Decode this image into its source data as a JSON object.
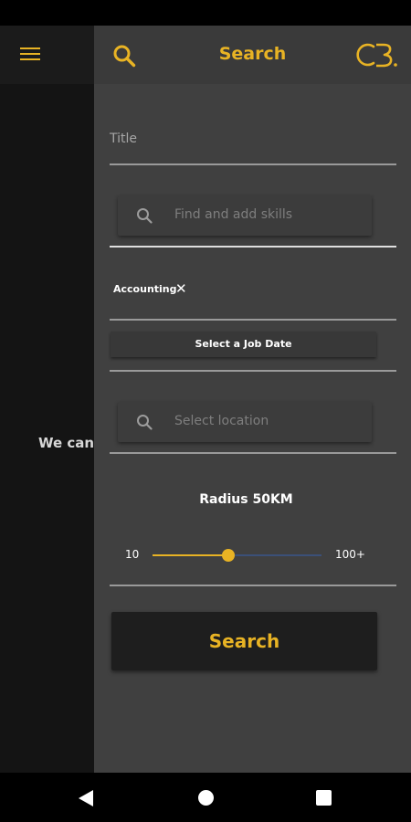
{
  "colors": {
    "accent": "#e8b324",
    "panel": "#404040",
    "slider_track": "#3b5078"
  },
  "background": {
    "message": "We can'"
  },
  "header": {
    "title": "Search",
    "logo_text": "CB.",
    "search_icon": "search-icon",
    "menu_icon": "hamburger-menu-icon"
  },
  "form": {
    "title_label": "Title",
    "skills_placeholder": "Find and add skills",
    "selected_skill": "Accounting",
    "job_date_button": "Select a Job Date",
    "location_placeholder": "Select location",
    "radius_label": "Radius 50KM",
    "slider": {
      "min_label": "10",
      "max_label": "100+",
      "value_fraction": 0.45
    },
    "search_button": "Search"
  },
  "nav": {
    "back_icon": "back-icon",
    "home_icon": "home-icon",
    "recent_icon": "recents-icon"
  }
}
